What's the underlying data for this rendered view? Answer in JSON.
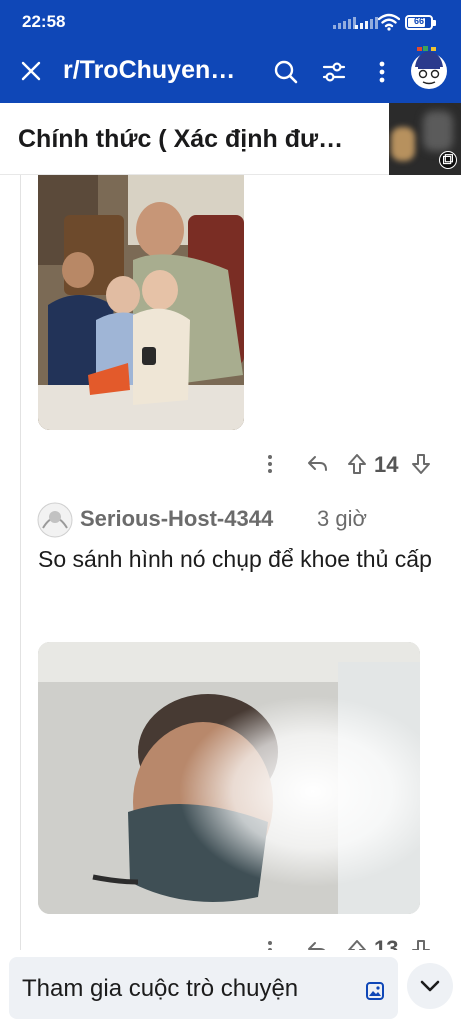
{
  "status_bar": {
    "time": "22:58",
    "battery": "66"
  },
  "header": {
    "subreddit": "r/TroChuyen…",
    "icons": [
      "close-icon",
      "search-icon",
      "filter-icon",
      "more-icon",
      "avatar"
    ]
  },
  "post": {
    "title": "Chính thức ( Xác định đư…",
    "thumbnail_icon": "gallery-icon"
  },
  "comment1": {
    "vote_count": "14",
    "icons": [
      "more-icon",
      "reply-icon",
      "upvote-icon",
      "downvote-icon"
    ]
  },
  "comment2": {
    "username": "Serious-Host-4344",
    "time": "3 giờ",
    "text": "So sánh hình nó chụp để khoe thủ cấp",
    "vote_count": "13"
  },
  "bottom": {
    "join_label": "Tham gia cuộc trò chuyện",
    "icons": [
      "image-icon",
      "chevron-down-icon"
    ]
  },
  "colors": {
    "header_bg": "#0f47b7",
    "text_primary": "#1c1c1c",
    "text_muted": "#6b6b6b",
    "input_bg": "#eef1f5"
  }
}
